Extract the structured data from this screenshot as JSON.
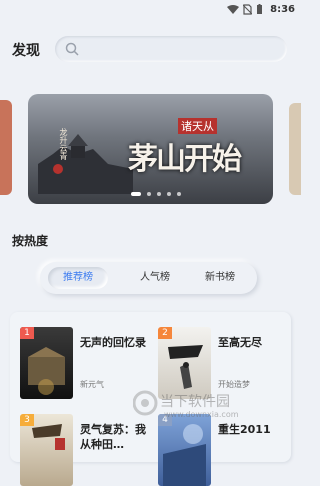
{
  "status_bar": {
    "time": "8:36"
  },
  "header": {
    "title": "发现"
  },
  "banner": {
    "title": "茅山开始",
    "subtitle": "诸天从",
    "vertical_text": "龙升云青",
    "dots_count": 5,
    "active_dot": 1
  },
  "section": {
    "title": "按热度",
    "tabs": [
      {
        "label": "推荐榜",
        "active": true
      },
      {
        "label": "人气榜",
        "active": false
      },
      {
        "label": "新书榜",
        "active": false
      }
    ]
  },
  "books": [
    {
      "rank": "1",
      "name": "无声的回忆录",
      "author": "新元气"
    },
    {
      "rank": "2",
      "name": "至高无尽",
      "author": "开始造梦"
    },
    {
      "rank": "3",
      "name": "灵气复苏：我从种田…",
      "author": ""
    },
    {
      "rank": "4",
      "name": "重生2011",
      "author": ""
    }
  ],
  "watermark": {
    "text": "当下软件园",
    "url": "www.downxia.com"
  },
  "colors": {
    "accent": "#3c7bf0",
    "background": "#eef1f6"
  }
}
